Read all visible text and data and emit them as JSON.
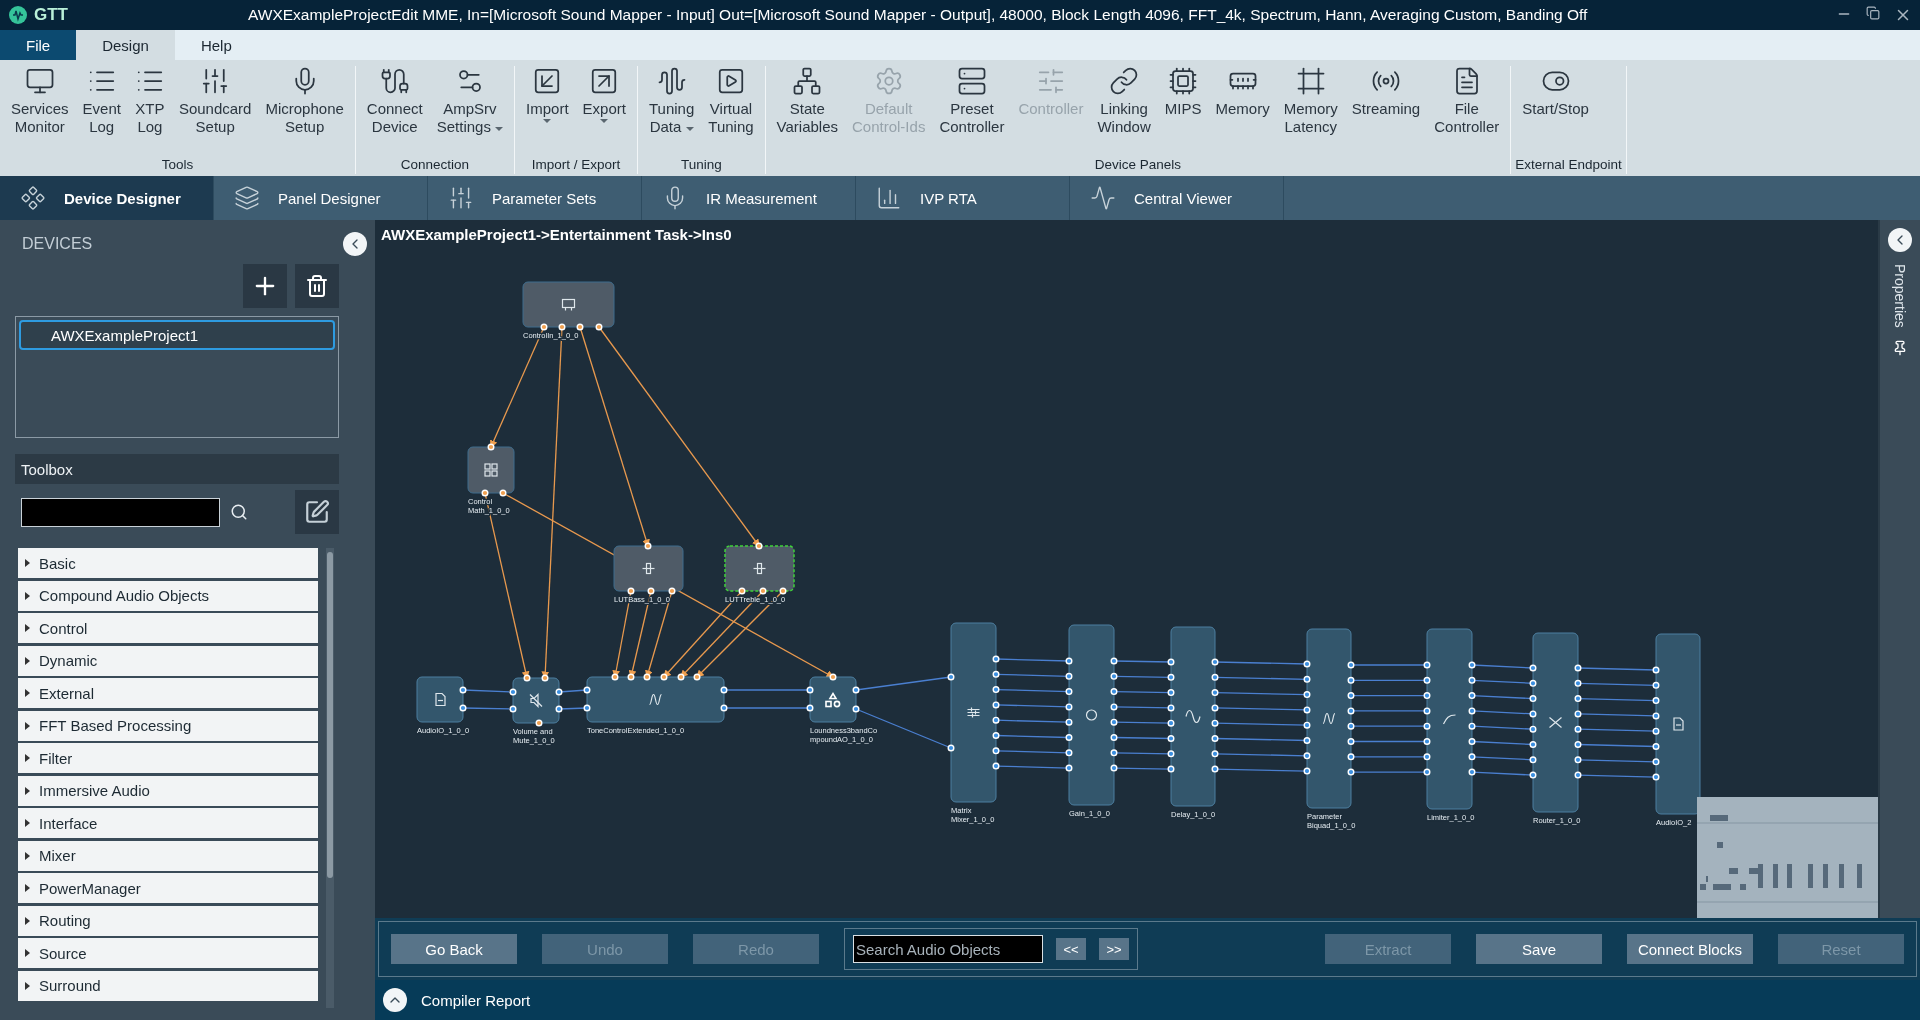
{
  "window": {
    "app_name": "GTT",
    "title": "AWXExampleProjectEdit MME, In=[Microsoft Sound Mapper - Input] Out=[Microsoft Sound Mapper - Output], 48000, Block Length 4096, FFT_4k, Spectrum, Hann, Averaging Custom, Banding Off"
  },
  "menu_tabs": [
    {
      "label": "File",
      "kind": "backstage",
      "selected": false
    },
    {
      "label": "Design",
      "kind": "tab",
      "selected": true
    },
    {
      "label": "Help",
      "kind": "tab",
      "selected": false
    }
  ],
  "ribbon_groups": [
    {
      "label": "Tools",
      "buttons": [
        {
          "label": "Services\nMonitor",
          "disabled": false,
          "dropdown": false
        },
        {
          "label": "Event\nLog",
          "disabled": false,
          "dropdown": false
        },
        {
          "label": "XTP\nLog",
          "disabled": false,
          "dropdown": false
        },
        {
          "label": "Soundcard\nSetup",
          "disabled": false,
          "dropdown": false
        },
        {
          "label": "Microphone\nSetup",
          "disabled": false,
          "dropdown": false
        }
      ]
    },
    {
      "label": "Connection",
      "buttons": [
        {
          "label": "Connect\nDevice",
          "disabled": false,
          "dropdown": false
        },
        {
          "label": "AmpSrv\nSettings",
          "disabled": false,
          "dropdown": true
        }
      ]
    },
    {
      "label": "Import / Export",
      "buttons": [
        {
          "label": "Import",
          "disabled": false,
          "dropdown": true
        },
        {
          "label": "Export",
          "disabled": false,
          "dropdown": true
        }
      ]
    },
    {
      "label": "Tuning",
      "buttons": [
        {
          "label": "Tuning\nData",
          "disabled": false,
          "dropdown": true
        },
        {
          "label": "Virtual\nTuning",
          "disabled": false,
          "dropdown": false
        }
      ]
    },
    {
      "label": "Device Panels",
      "buttons": [
        {
          "label": "State\nVariables",
          "disabled": false,
          "dropdown": false
        },
        {
          "label": "Default\nControl-Ids",
          "disabled": true,
          "dropdown": false
        },
        {
          "label": "Preset\nController",
          "disabled": false,
          "dropdown": false
        },
        {
          "label": "Controller",
          "disabled": true,
          "dropdown": false
        },
        {
          "label": "Linking\nWindow",
          "disabled": false,
          "dropdown": false
        },
        {
          "label": "MIPS",
          "disabled": false,
          "dropdown": false
        },
        {
          "label": "Memory",
          "disabled": false,
          "dropdown": false
        },
        {
          "label": "Memory\nLatency",
          "disabled": false,
          "dropdown": false
        },
        {
          "label": "Streaming",
          "disabled": false,
          "dropdown": false
        },
        {
          "label": "File\nController",
          "disabled": false,
          "dropdown": false
        }
      ]
    },
    {
      "label": "External Endpoint",
      "buttons": [
        {
          "label": "Start/Stop",
          "disabled": false,
          "dropdown": false
        }
      ]
    }
  ],
  "designer_tabs": [
    {
      "label": "Device Designer",
      "selected": true
    },
    {
      "label": "Panel Designer",
      "selected": false
    },
    {
      "label": "Parameter Sets",
      "selected": false
    },
    {
      "label": "IR Measurement",
      "selected": false
    },
    {
      "label": "IVP RTA",
      "selected": false
    },
    {
      "label": "Central Viewer",
      "selected": false
    }
  ],
  "devices": {
    "title": "DEVICES",
    "items": [
      {
        "label": "AWXExampleProject1",
        "selected": true
      }
    ]
  },
  "toolbox": {
    "title": "Toolbox",
    "categories": [
      {
        "label": "Basic",
        "expanded": false
      },
      {
        "label": "Compound Audio Objects",
        "expanded": false
      },
      {
        "label": "Control",
        "expanded": false
      },
      {
        "label": "Dynamic",
        "expanded": false
      },
      {
        "label": "External",
        "expanded": false
      },
      {
        "label": "FFT Based Processing",
        "expanded": false
      },
      {
        "label": "Filter",
        "expanded": false
      },
      {
        "label": "Immersive Audio",
        "expanded": false
      },
      {
        "label": "Interface",
        "expanded": false
      },
      {
        "label": "Mixer",
        "expanded": false
      },
      {
        "label": "PowerManager",
        "expanded": false
      },
      {
        "label": "Routing",
        "expanded": false
      },
      {
        "label": "Source",
        "expanded": false
      },
      {
        "label": "Surround",
        "expanded": false
      }
    ]
  },
  "canvas": {
    "breadcrumb": "AWXExampleProject1->Entertainment Task->Ins0",
    "blocks": [
      {
        "label": "ControlIn_1_0_0",
        "kind": "control",
        "selected": false
      },
      {
        "label": "Control\nMath_1_0_0",
        "kind": "control",
        "selected": false
      },
      {
        "label": "LUTBass_1_0_0",
        "kind": "control",
        "selected": false
      },
      {
        "label": "LUTTreble_1_0_0",
        "kind": "control",
        "selected": true
      },
      {
        "label": "AudioIO_1_0_0",
        "kind": "audio",
        "selected": false
      },
      {
        "label": "Volume and\nMute_1_0_0",
        "kind": "audio",
        "selected": false
      },
      {
        "label": "ToneControlExtended_1_0_0",
        "kind": "audio",
        "selected": false
      },
      {
        "label": "Loundness3bandCo\nmpoundAO_1_0_0",
        "kind": "audio",
        "selected": false
      },
      {
        "label": "Matrix\nMixer_1_0_0",
        "kind": "audio",
        "selected": false
      },
      {
        "label": "Gain_1_0_0",
        "kind": "audio",
        "selected": false
      },
      {
        "label": "Delay_1_0_0",
        "kind": "audio",
        "selected": false
      },
      {
        "label": "Parameter\nBiquad_1_0_0",
        "kind": "audio",
        "selected": false
      },
      {
        "label": "Limiter_1_0_0",
        "kind": "audio",
        "selected": false
      },
      {
        "label": "Router_1_0_0",
        "kind": "audio",
        "selected": false
      },
      {
        "label": "AudioIO_2",
        "kind": "audio",
        "selected": false
      }
    ]
  },
  "properties_panel": {
    "title": "Properties"
  },
  "bottom_toolbar": {
    "buttons_left": [
      {
        "label": "Go Back",
        "disabled": false
      },
      {
        "label": "Undo",
        "disabled": true
      },
      {
        "label": "Redo",
        "disabled": true
      }
    ],
    "search": {
      "placeholder": "Search Audio Objects"
    },
    "nav_buttons": [
      "<<",
      ">>"
    ],
    "buttons_right": [
      {
        "label": "Extract",
        "disabled": true
      },
      {
        "label": "Save",
        "disabled": false
      },
      {
        "label": "Connect Blocks",
        "disabled": false
      },
      {
        "label": "Reset",
        "disabled": true
      }
    ]
  },
  "compiler_report": {
    "label": "Compiler Report",
    "expanded": false
  }
}
